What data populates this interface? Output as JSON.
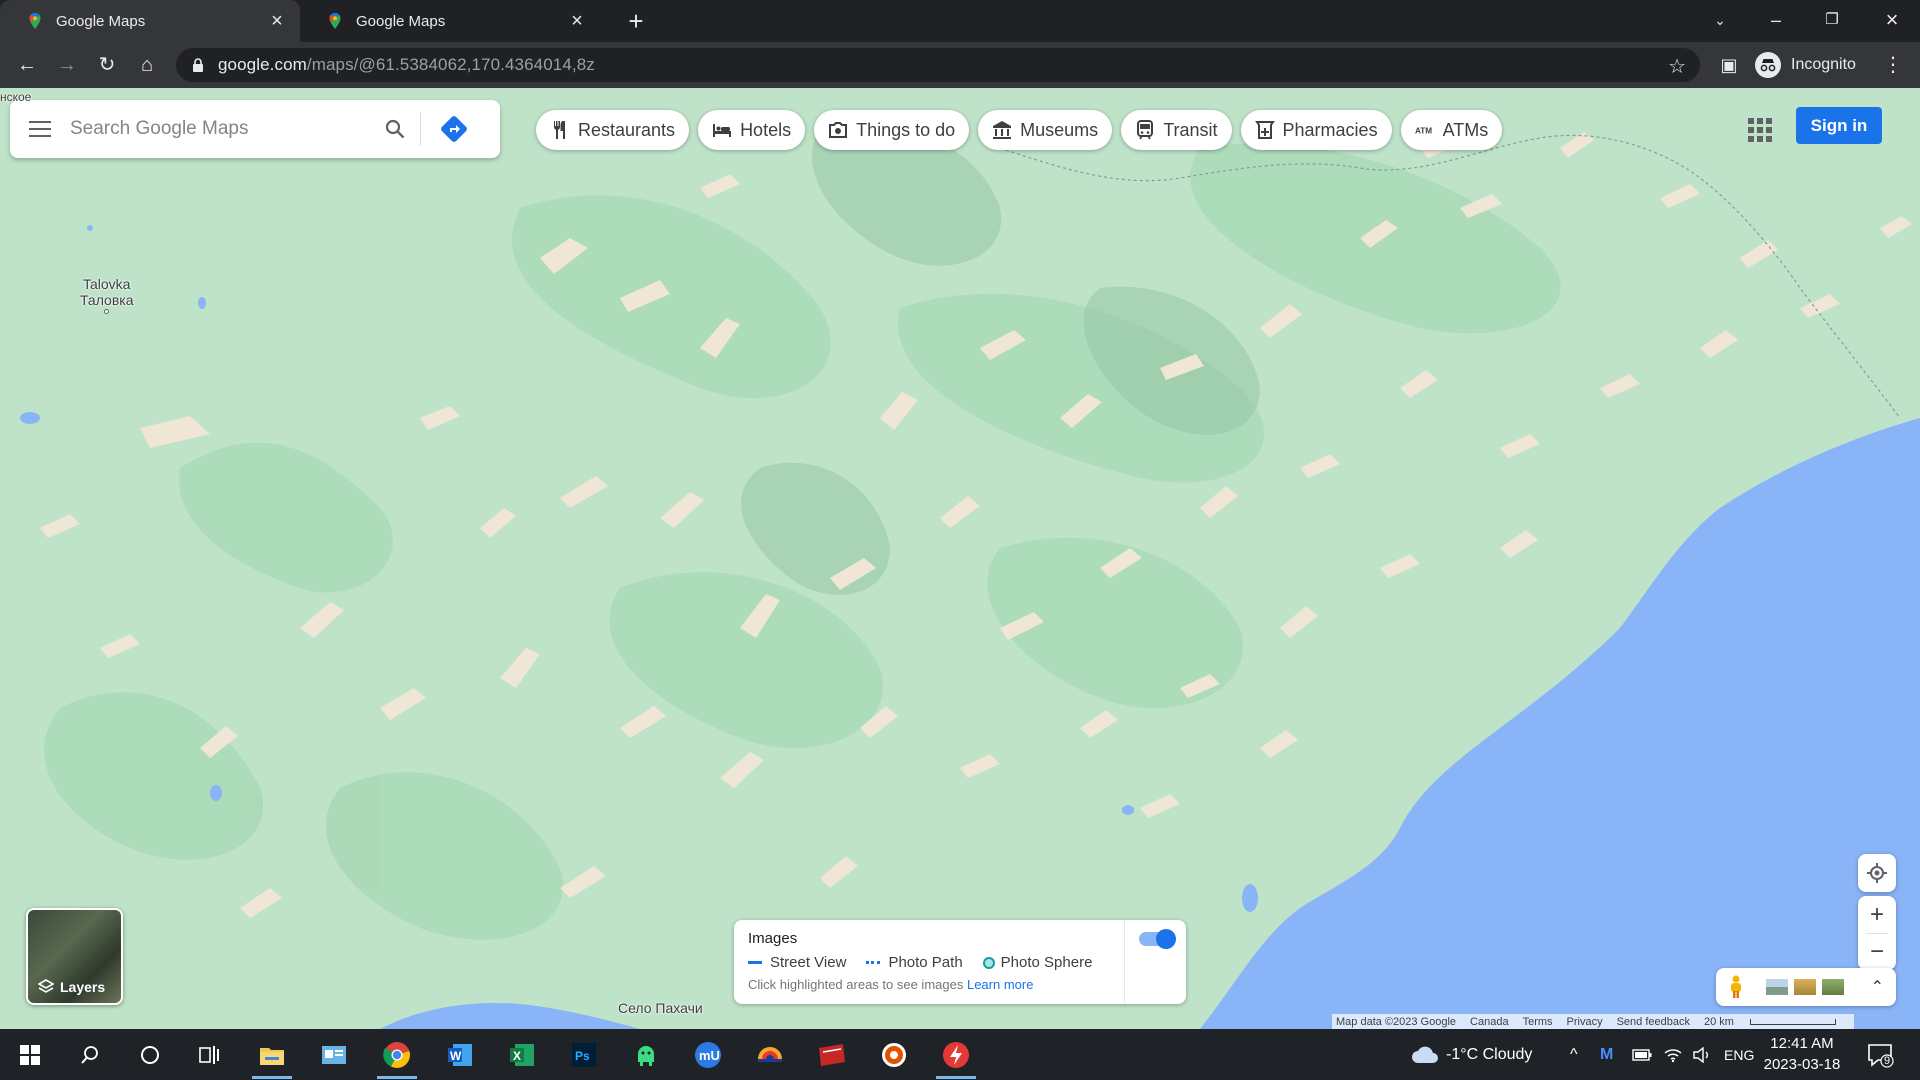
{
  "browser": {
    "tabs": [
      {
        "title": "Google Maps",
        "active": true
      },
      {
        "title": "Google Maps",
        "active": false
      }
    ],
    "url_host": "google.com",
    "url_rest": "/maps/@61.5384062,170.4364014,8z",
    "profile_label": "Incognito"
  },
  "maps": {
    "search_placeholder": "Search Google Maps",
    "chips": [
      {
        "label": "Restaurants",
        "icon": "fork-knife-icon"
      },
      {
        "label": "Hotels",
        "icon": "bed-icon"
      },
      {
        "label": "Things to do",
        "icon": "camera-icon"
      },
      {
        "label": "Museums",
        "icon": "museum-icon"
      },
      {
        "label": "Transit",
        "icon": "train-icon"
      },
      {
        "label": "Pharmacies",
        "icon": "pharmacy-icon"
      },
      {
        "label": "ATMs",
        "icon": "atm-icon"
      }
    ],
    "signin_label": "Sign in",
    "places": {
      "top_left_fragment": "нское",
      "talovka_en": "Talovka",
      "talovka_ru": "Таловка",
      "pakhachi": "Село Пахачи"
    },
    "layers_label": "Layers",
    "images_panel": {
      "title": "Images",
      "legend": [
        "Street View",
        "Photo Path",
        "Photo Sphere"
      ],
      "hint": "Click highlighted areas to see images",
      "learn_more": "Learn more",
      "toggle_on": true
    },
    "attribution": {
      "map_data": "Map data ©2023 Google",
      "country": "Canada",
      "terms": "Terms",
      "privacy": "Privacy",
      "feedback": "Send feedback",
      "scale_label": "20 km"
    },
    "colors": {
      "land": "#bfe3c8",
      "land_dark": "#9fd5ad",
      "peaks": "#efe6d6",
      "water": "#8ab4f8",
      "accent": "#1a73e8"
    }
  },
  "taskbar": {
    "weather": "-1°C Cloudy",
    "lang": "ENG",
    "time": "12:41 AM",
    "date": "2023-03-18",
    "notifications": "9",
    "apps": [
      "start-icon",
      "search-icon",
      "cortana-icon",
      "task-view-icon",
      "file-explorer-icon",
      "mail-app-icon",
      "chrome-icon",
      "word-icon",
      "excel-icon",
      "photoshop-icon",
      "android-app-icon",
      "mu-app-icon",
      "app-icon",
      "red-app-icon",
      "media-player-icon",
      "flash-app-icon"
    ]
  }
}
